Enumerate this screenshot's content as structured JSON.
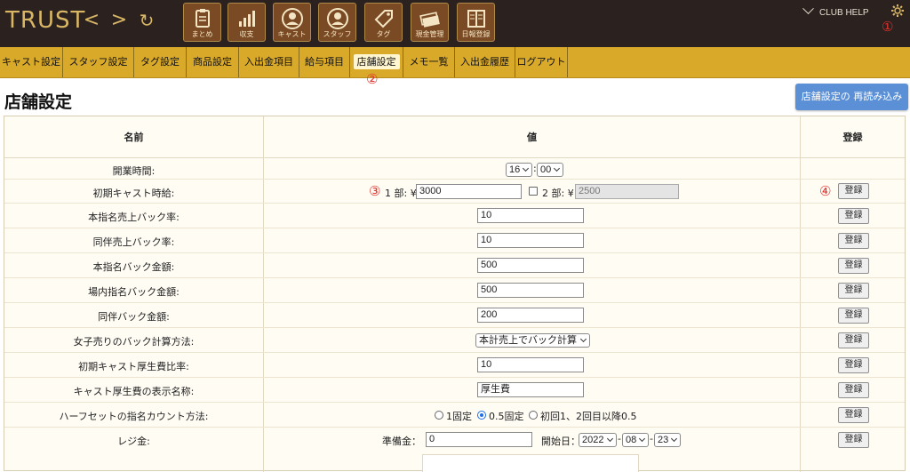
{
  "header": {
    "logo": "TRUST",
    "back": "<",
    "forward": ">",
    "refresh": "↻",
    "tiles": [
      "まとめ",
      "収支",
      "キャスト",
      "スタッフ",
      "タグ",
      "現金管理",
      "日報登録"
    ],
    "club_help": "CLUB HELP",
    "marker_1": "①"
  },
  "menu": {
    "items": [
      "キャスト設定",
      "スタッフ設定",
      "タグ設定",
      "商品設定",
      "入出金項目",
      "給与項目",
      "店舗設定",
      "メモ一覧",
      "入出金履歴",
      "ログアウト"
    ],
    "active": "店舗設定",
    "marker_2": "②"
  },
  "page": {
    "title": "店舗設定",
    "reload_button": "店舗設定の 再読み込み"
  },
  "table": {
    "headers": {
      "name": "名前",
      "value": "値",
      "register": "登録"
    },
    "register_label": "登録",
    "marker_3": "③",
    "marker_4": "④",
    "rows": {
      "open_time": {
        "label": "開業時間:",
        "hour": "16",
        "minute": "00"
      },
      "cast_wage": {
        "label": "初期キャスト時給:",
        "part1_label": "1 部: ¥",
        "part1_value": "3000",
        "part2_label": "2 部: ¥",
        "part2_value": "2500"
      },
      "r3": {
        "label": "本指名売上バック率:",
        "value": "10"
      },
      "r4": {
        "label": "同伴売上バック率:",
        "value": "10"
      },
      "r5": {
        "label": "本指名バック金額:",
        "value": "500"
      },
      "r6": {
        "label": "場内指名バック金額:",
        "value": "500"
      },
      "r7": {
        "label": "同伴バック金額:",
        "value": "200"
      },
      "r8": {
        "label": "女子売りのバック計算方法:",
        "value": "本計売上でバック計算"
      },
      "r9": {
        "label": "初期キャスト厚生費比率:",
        "value": "10"
      },
      "r10": {
        "label": "キャスト厚生費の表示名称:",
        "value": "厚生費"
      },
      "r11": {
        "label": "ハーフセットの指名カウント方法:",
        "opt1": "1固定",
        "opt2": "0.5固定",
        "opt3": "初回1、2回目以降0.5"
      },
      "r12": {
        "label": "レジ金:",
        "reserve_label": "準備金：",
        "reserve_value": "0",
        "start_label": "開始日：",
        "year": "2022",
        "month": "08",
        "day": "23"
      }
    }
  },
  "colors": {
    "topbar": "#2b2220",
    "menubar": "#d9a92a",
    "tile": "#7a4a24",
    "accent_gold": "#d9b765",
    "reload_button": "#5b8fd6",
    "marker_red": "#e3302a"
  }
}
